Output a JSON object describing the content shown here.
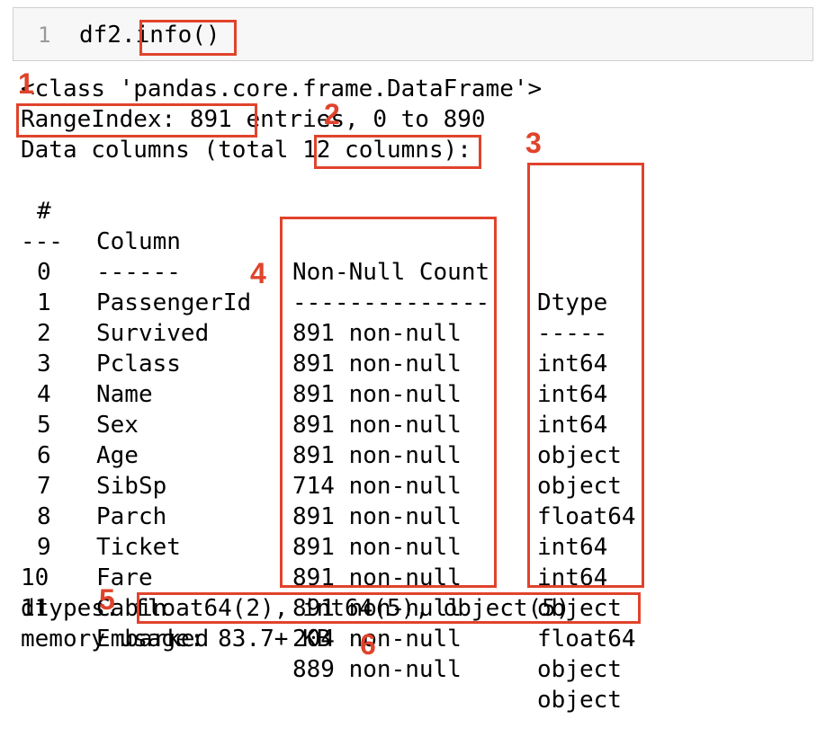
{
  "input_cell": {
    "line_number": "1",
    "code_prefix": "df2.",
    "code_call": "info()"
  },
  "output": {
    "class_line": "<class 'pandas.core.frame.DataFrame'>",
    "range_index": "RangeIndex: 891",
    "entries_suffix": " entries, 0 to 890",
    "data_columns_prefix": "Data columns (total ",
    "columns_count": "12 columns",
    "data_columns_suffix": "):",
    "header": {
      "index": "#",
      "column": "Column",
      "non_null_count": "Non-Null Count",
      "dtype": "Dtype"
    },
    "separator": {
      "index": "---",
      "column": "------",
      "non_null_count": "--------------",
      "dtype": "-----"
    },
    "rows": [
      {
        "index": "0",
        "column": "PassengerId",
        "count": "891 non-null",
        "dtype": "int64"
      },
      {
        "index": "1",
        "column": "Survived",
        "count": "891 non-null",
        "dtype": "int64"
      },
      {
        "index": "2",
        "column": "Pclass",
        "count": "891 non-null",
        "dtype": "int64"
      },
      {
        "index": "3",
        "column": "Name",
        "count": "891 non-null",
        "dtype": "object"
      },
      {
        "index": "4",
        "column": "Sex",
        "count": "891 non-null",
        "dtype": "object"
      },
      {
        "index": "5",
        "column": "Age",
        "count": "714 non-null",
        "dtype": "float64"
      },
      {
        "index": "6",
        "column": "SibSp",
        "count": "891 non-null",
        "dtype": "int64"
      },
      {
        "index": "7",
        "column": "Parch",
        "count": "891 non-null",
        "dtype": "int64"
      },
      {
        "index": "8",
        "column": "Ticket",
        "count": "891 non-null",
        "dtype": "object"
      },
      {
        "index": "9",
        "column": "Fare",
        "count": "891 non-null",
        "dtype": "float64"
      },
      {
        "index": "10",
        "column": "Cabin",
        "count": "204 non-null",
        "dtype": "object"
      },
      {
        "index": "11",
        "column": "Embarked",
        "count": "889 non-null",
        "dtype": "object"
      }
    ],
    "dtypes_label": "dtypes:",
    "dtypes_value": "float64(2), int64(5), object(5)",
    "memory_usage": "memory usage: 83.7+ KB"
  },
  "annotations": {
    "color": "#e0432b",
    "labels": [
      "1",
      "2",
      "3",
      "4",
      "5",
      "6"
    ]
  }
}
